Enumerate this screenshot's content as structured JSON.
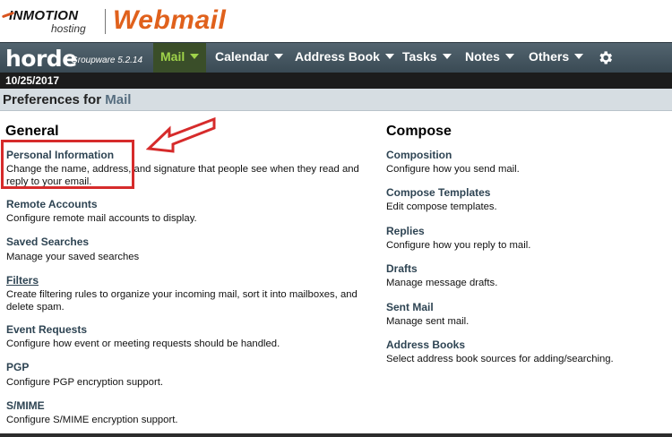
{
  "brand": {
    "company": "INMOTION",
    "company_sub": "hosting",
    "product": "Webmail"
  },
  "nav": {
    "logo": "horde",
    "logo_sub": "Groupware 5.2.14",
    "items": [
      {
        "label": "Mail",
        "active": true
      },
      {
        "label": "Calendar"
      },
      {
        "label": "Address Book"
      },
      {
        "label": "Tasks"
      },
      {
        "label": "Notes"
      },
      {
        "label": "Others"
      }
    ],
    "settings_icon": "gear-icon"
  },
  "date": "10/25/2017",
  "page_title": {
    "prefix": "Preferences for",
    "app": "Mail"
  },
  "general": {
    "heading": "General",
    "items": [
      {
        "title": "Personal Information",
        "desc_lines": [
          "Change the name, address, and signature that people see when they read and",
          "reply to your email."
        ]
      },
      {
        "title": "Remote Accounts",
        "desc_lines": [
          "Configure remote mail accounts to display."
        ]
      },
      {
        "title": "Saved Searches",
        "desc_lines": [
          "Manage your saved searches"
        ]
      },
      {
        "title": "Filters",
        "desc_lines": [
          "Create filtering rules to organize your incoming mail, sort it into mailboxes, and",
          "delete spam."
        ]
      },
      {
        "title": "Event Requests",
        "desc_lines": [
          "Configure how event or meeting requests should be handled."
        ]
      },
      {
        "title": "PGP",
        "desc_lines": [
          "Configure PGP encryption support."
        ]
      },
      {
        "title": "S/MIME",
        "desc_lines": [
          "Configure S/MIME encryption support."
        ]
      }
    ]
  },
  "compose": {
    "heading": "Compose",
    "items": [
      {
        "title": "Composition",
        "desc_lines": [
          "Configure how you send mail."
        ]
      },
      {
        "title": "Compose Templates",
        "desc_lines": [
          "Edit compose templates."
        ]
      },
      {
        "title": "Replies",
        "desc_lines": [
          "Configure how you reply to mail."
        ]
      },
      {
        "title": "Drafts",
        "desc_lines": [
          "Manage message drafts."
        ]
      },
      {
        "title": "Sent Mail",
        "desc_lines": [
          "Manage sent mail."
        ]
      },
      {
        "title": "Address Books",
        "desc_lines": [
          "Select address book sources for adding/searching."
        ]
      }
    ]
  },
  "colors": {
    "nav_bg": "#445660",
    "active_tab_text": "#9fd34a",
    "highlight": "#d62b2b",
    "brand_orange": "#e0611c"
  }
}
